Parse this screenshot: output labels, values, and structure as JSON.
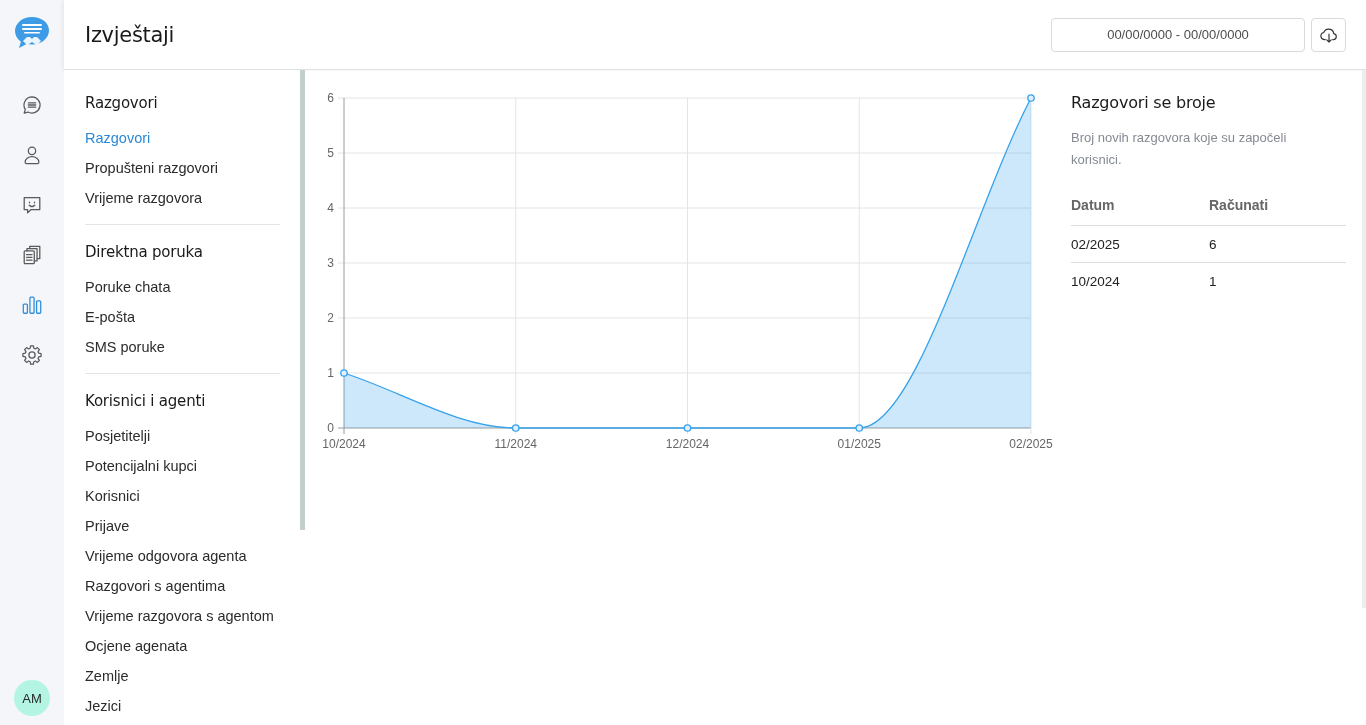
{
  "nav_rail": {
    "items": [
      {
        "kind": "chats",
        "selected": false
      },
      {
        "kind": "contacts",
        "selected": false
      },
      {
        "kind": "feedback",
        "selected": false
      },
      {
        "kind": "documents",
        "selected": false
      },
      {
        "kind": "reports",
        "selected": true
      },
      {
        "kind": "settings",
        "selected": false
      }
    ]
  },
  "user": {
    "initials": "AM"
  },
  "header": {
    "title": "Izvještaji",
    "date_range": {
      "placeholder": "00/00/0000 - 00/00/0000"
    }
  },
  "report_menu": {
    "sections": [
      {
        "title": "Razgovori",
        "items": [
          {
            "label": "Razgovori",
            "selected": true
          },
          {
            "label": "Propušteni razgovori",
            "selected": false
          },
          {
            "label": "Vrijeme razgovora",
            "selected": false
          }
        ]
      },
      {
        "title": "Direktna poruka",
        "items": [
          {
            "label": "Poruke chata",
            "selected": false
          },
          {
            "label": "E-pošta",
            "selected": false
          },
          {
            "label": "SMS poruke",
            "selected": false
          }
        ]
      },
      {
        "title": "Korisnici i agenti",
        "items": [
          {
            "label": "Posjetitelji",
            "selected": false
          },
          {
            "label": "Potencijalni kupci",
            "selected": false
          },
          {
            "label": "Korisnici",
            "selected": false
          },
          {
            "label": "Prijave",
            "selected": false
          },
          {
            "label": "Vrijeme odgovora agenta",
            "selected": false
          },
          {
            "label": "Razgovori s agentima",
            "selected": false
          },
          {
            "label": "Vrijeme razgovora s agentom",
            "selected": false
          },
          {
            "label": "Ocjene agenata",
            "selected": false
          },
          {
            "label": "Zemlje",
            "selected": false
          },
          {
            "label": "Jezici",
            "selected": false
          }
        ]
      }
    ]
  },
  "chart": {
    "chart_data": {
      "type": "area",
      "categories": [
        "10/2024",
        "11/2024",
        "12/2024",
        "01/2025",
        "02/2025"
      ],
      "series": [
        {
          "color": "#36a2eb",
          "values": [
            1,
            0,
            0,
            0,
            6
          ]
        }
      ],
      "ylim": [
        0,
        6
      ],
      "yticks": [
        0,
        1,
        2,
        3,
        4,
        5,
        6
      ],
      "grid": true
    }
  },
  "summary": {
    "title": "Razgovori se broje",
    "description": "Broj novih razgovora koje su započeli korisnici.",
    "table": {
      "columns": [
        "Datum",
        "Računati"
      ],
      "rows": [
        [
          "02/2025",
          "6"
        ],
        [
          "10/2024",
          "1"
        ]
      ]
    }
  }
}
